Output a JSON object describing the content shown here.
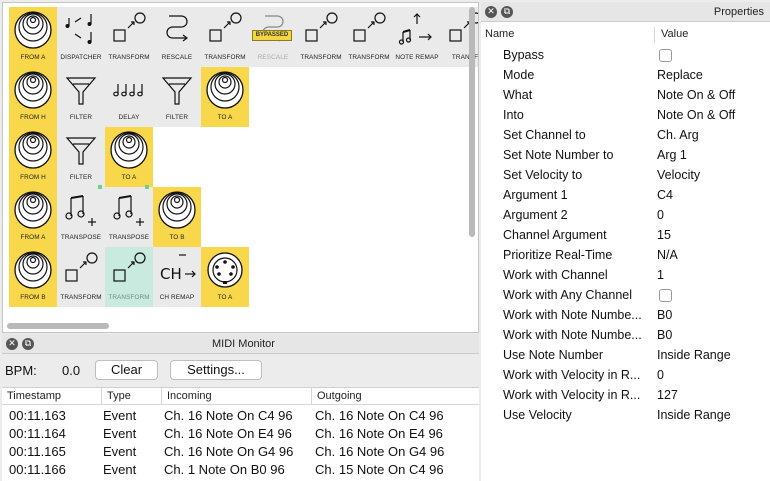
{
  "graph": {
    "tiles": [
      {
        "label": "FROM A",
        "kind": "io",
        "icon": "midi-port-icon"
      },
      {
        "label": "DISPATCHER",
        "kind": "proc",
        "icon": "dispatcher-icon"
      },
      {
        "label": "TRANSFORM",
        "kind": "proc",
        "icon": "transform-icon"
      },
      {
        "label": "RESCALE",
        "kind": "proc",
        "icon": "rescale-icon"
      },
      {
        "label": "TRANSFORM",
        "kind": "proc",
        "icon": "transform-icon"
      },
      {
        "label": "RESCALE",
        "kind": "proc",
        "icon": "rescale-icon",
        "badge": "BYPASSED"
      },
      {
        "label": "TRANSFORM",
        "kind": "proc",
        "icon": "transform-icon"
      },
      {
        "label": "TRANSFORM",
        "kind": "proc",
        "icon": "transform-icon"
      },
      {
        "label": "NOTE REMAP",
        "kind": "proc",
        "icon": "note-remap-icon"
      },
      {
        "label": "TRANSF",
        "kind": "proc",
        "icon": "transform-icon"
      },
      {
        "label": "FROM H",
        "kind": "io",
        "icon": "midi-port-icon"
      },
      {
        "label": "FILTER",
        "kind": "proc",
        "icon": "filter-icon"
      },
      {
        "label": "DELAY",
        "kind": "proc",
        "icon": "delay-icon"
      },
      {
        "label": "FILTER",
        "kind": "proc",
        "icon": "filter-icon"
      },
      {
        "label": "TO A",
        "kind": "io",
        "icon": "midi-port-icon"
      },
      {
        "label": "FROM H",
        "kind": "io",
        "icon": "midi-port-icon"
      },
      {
        "label": "FILTER",
        "kind": "proc",
        "icon": "filter-icon"
      },
      {
        "label": "TO A",
        "kind": "io",
        "icon": "midi-port-icon"
      },
      {
        "label": "FROM A",
        "kind": "io",
        "icon": "midi-port-icon"
      },
      {
        "label": "TRANSPOSE",
        "kind": "proc",
        "icon": "transpose-icon"
      },
      {
        "label": "TRANSPOSE",
        "kind": "proc",
        "icon": "transpose-icon"
      },
      {
        "label": "TO B",
        "kind": "io",
        "icon": "midi-port-icon"
      },
      {
        "label": "FROM B",
        "kind": "io",
        "icon": "midi-port-icon"
      },
      {
        "label": "TRANSFORM",
        "kind": "proc",
        "icon": "transform-icon"
      },
      {
        "label": "TRANSFORM",
        "kind": "hl",
        "icon": "transform-icon"
      },
      {
        "label": "CH REMAP",
        "kind": "proc",
        "icon": "channel-remap-icon"
      },
      {
        "label": "TO A",
        "kind": "io",
        "icon": "midi-din-icon"
      }
    ]
  },
  "monitor": {
    "title": "MIDI Monitor",
    "bpm_label": "BPM:",
    "bpm_value": "0.0",
    "clear_label": "Clear",
    "settings_label": "Settings...",
    "columns": [
      "Timestamp",
      "Type",
      "Incoming",
      "Outgoing"
    ],
    "rows": [
      {
        "timestamp": "00:11.163",
        "type": "Event",
        "incoming": "Ch. 16 Note On C4 96",
        "outgoing": "Ch. 16 Note On C4 96"
      },
      {
        "timestamp": "00:11.164",
        "type": "Event",
        "incoming": "Ch. 16 Note On E4 96",
        "outgoing": "Ch. 16 Note On E4 96"
      },
      {
        "timestamp": "00:11.165",
        "type": "Event",
        "incoming": "Ch. 16 Note On G4 96",
        "outgoing": "Ch. 16 Note On G4 96"
      },
      {
        "timestamp": "00:11.166",
        "type": "Event",
        "incoming": "Ch. 1 Note On B0 96",
        "outgoing": "Ch. 15 Note On C4 96"
      }
    ]
  },
  "properties": {
    "title": "Properties",
    "col_name": "Name",
    "col_value": "Value",
    "rows": [
      {
        "name": "Bypass",
        "checkbox": true
      },
      {
        "name": "Mode",
        "value": "Replace"
      },
      {
        "name": "What",
        "value": "Note On & Off"
      },
      {
        "name": "Into",
        "value": "Note On & Off"
      },
      {
        "name": "Set Channel to",
        "value": "Ch. Arg"
      },
      {
        "name": "Set Note Number to",
        "value": "Arg 1"
      },
      {
        "name": "Set Velocity to",
        "value": "Velocity"
      },
      {
        "name": "Argument 1",
        "value": "C4"
      },
      {
        "name": "Argument 2",
        "value": "0"
      },
      {
        "name": "Channel Argument",
        "value": "15"
      },
      {
        "name": "Prioritize Real-Time",
        "value": "N/A"
      },
      {
        "name": "Work with Channel",
        "value": "1"
      },
      {
        "name": "Work with Any Channel",
        "checkbox": true
      },
      {
        "name": "Work with Note Numbe...",
        "value": "B0"
      },
      {
        "name": "Work with Note Numbe...",
        "value": "B0"
      },
      {
        "name": "Use Note Number",
        "value": "Inside Range"
      },
      {
        "name": "Work with Velocity in R...",
        "value": "0"
      },
      {
        "name": "Work with Velocity in R...",
        "value": "127"
      },
      {
        "name": "Use Velocity",
        "value": "Inside Range"
      }
    ]
  }
}
